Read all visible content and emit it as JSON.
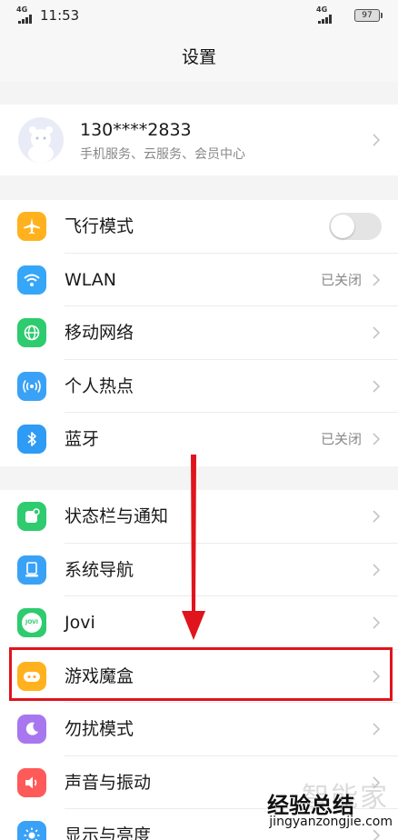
{
  "status_bar": {
    "time": "11:53",
    "network_left": "4G",
    "network_right": "4G",
    "battery": "97"
  },
  "header": {
    "title": "设置"
  },
  "account": {
    "phone": "130****2833",
    "subtitle": "手机服务、云服务、会员中心"
  },
  "section1": [
    {
      "label": "飞行模式",
      "icon": "airplane-icon",
      "color": "#ffb21e",
      "toggle": false
    },
    {
      "label": "WLAN",
      "icon": "wifi-icon",
      "color": "#36a6f8",
      "value": "已关闭"
    },
    {
      "label": "移动网络",
      "icon": "globe-icon",
      "color": "#2ecb6f"
    },
    {
      "label": "个人热点",
      "icon": "hotspot-icon",
      "color": "#3aa2f6"
    },
    {
      "label": "蓝牙",
      "icon": "bluetooth-icon",
      "color": "#2e9bf5",
      "value": "已关闭"
    }
  ],
  "section2": [
    {
      "label": "状态栏与通知",
      "icon": "notification-icon",
      "color": "#2ecb6f"
    },
    {
      "label": "系统导航",
      "icon": "navigation-icon",
      "color": "#3aa2f6"
    },
    {
      "label": "Jovi",
      "icon": "jovi-icon",
      "color": "#2ecb6f",
      "icon_text": "JOVI"
    },
    {
      "label": "游戏魔盒",
      "icon": "gamepad-icon",
      "color": "#ffb21e"
    },
    {
      "label": "勿扰模式",
      "icon": "moon-icon",
      "color": "#a877f0"
    },
    {
      "label": "声音与振动",
      "icon": "speaker-icon",
      "color": "#ff5a5a"
    },
    {
      "label": "显示与亮度",
      "icon": "brightness-icon",
      "color": "#3aa2f6"
    }
  ],
  "watermark": {
    "ghost": "智能家",
    "main": "经验总结",
    "url": "jingyanzongjie.com"
  },
  "colors": {
    "highlight": "#e0141c",
    "arrow": "#e0141c",
    "background": "#f4f4f4"
  }
}
